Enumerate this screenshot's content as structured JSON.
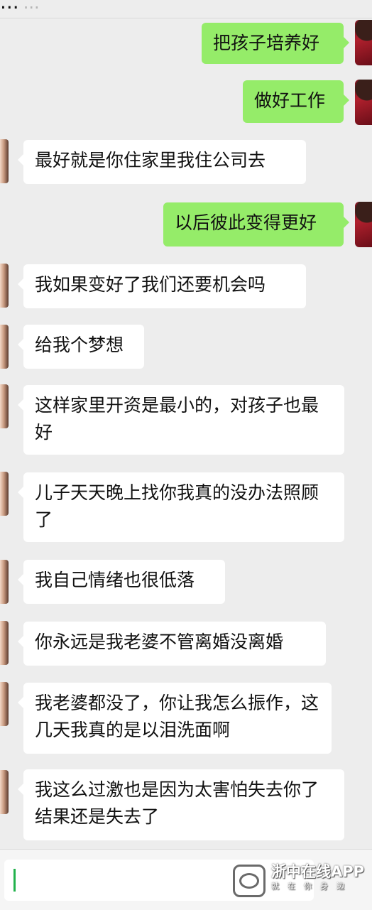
{
  "header": {
    "title": "...",
    "title_tail": "..."
  },
  "messages": [
    {
      "from": "me",
      "text": "把孩子培养好"
    },
    {
      "from": "me",
      "text": "做好工作"
    },
    {
      "from": "him",
      "text": "最好就是你住家里我住公司去"
    },
    {
      "from": "me",
      "text": "以后彼此变得更好"
    },
    {
      "from": "him",
      "text": "我如果变好了我们还要机会吗"
    },
    {
      "from": "him",
      "text": "给我个梦想"
    },
    {
      "from": "him",
      "text": "这样家里开资是最小的，对孩子也最好"
    },
    {
      "from": "him",
      "text": "儿子天天晚上找你我真的没办法照顾了"
    },
    {
      "from": "him",
      "text": "我自己情绪也很低落"
    },
    {
      "from": "him",
      "text": "你永远是我老婆不管离婚没离婚"
    },
    {
      "from": "him",
      "text": "我老婆都没了，你让我怎么振作，这几天我真的是以泪洗面啊"
    },
    {
      "from": "him",
      "text": "我这么过激也是因为太害怕失去你了结果还是失去了"
    }
  ],
  "watermark": {
    "name": "浙中在线APP",
    "slogan": "就在你身边"
  }
}
